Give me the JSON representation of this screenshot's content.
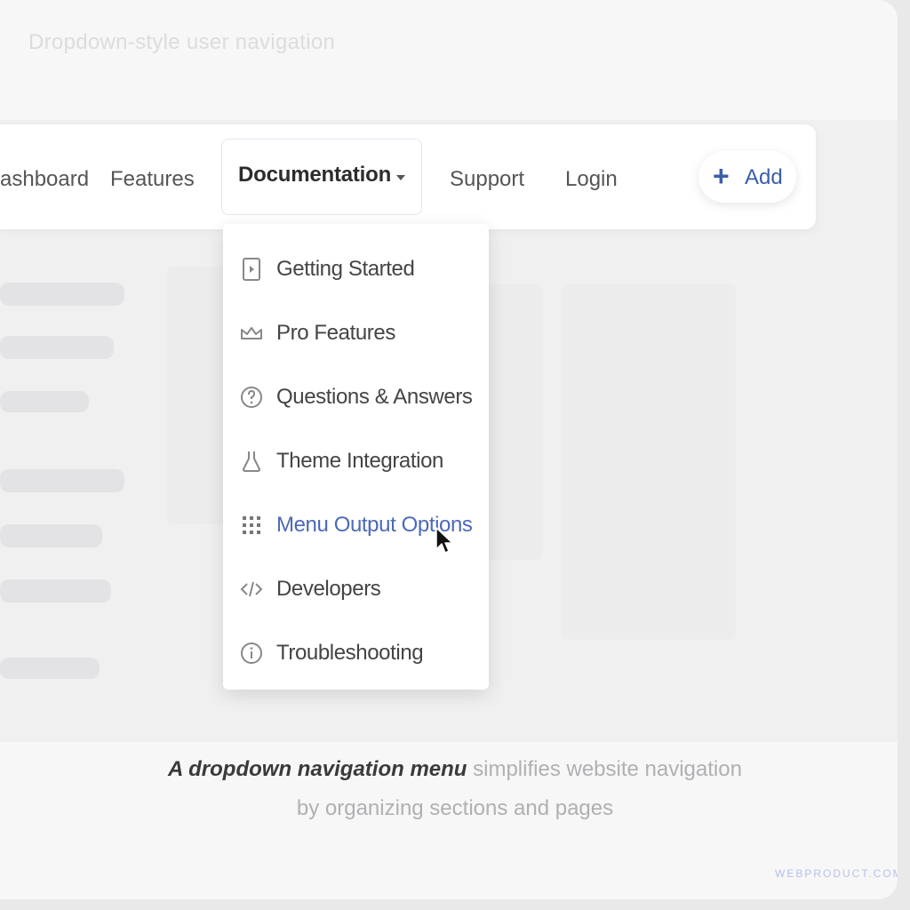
{
  "page_heading": "Dropdown-style user navigation",
  "nav": {
    "items": [
      {
        "label": "ashboard"
      },
      {
        "label": "Features"
      },
      {
        "label": "Documentation"
      },
      {
        "label": "Support"
      },
      {
        "label": "Login"
      }
    ],
    "add_button": {
      "icon": "+",
      "label": "Add"
    }
  },
  "dropdown": {
    "items": [
      {
        "label": "Getting Started",
        "icon": "play-box-icon"
      },
      {
        "label": "Pro Features",
        "icon": "crown-icon"
      },
      {
        "label": "Questions & Answers",
        "icon": "question-circle-icon"
      },
      {
        "label": "Theme Integration",
        "icon": "flask-icon"
      },
      {
        "label": "Menu Output Options",
        "icon": "grid-icon",
        "active": true
      },
      {
        "label": "Developers",
        "icon": "code-icon"
      },
      {
        "label": "Troubleshooting",
        "icon": "info-circle-icon"
      }
    ]
  },
  "caption": {
    "bold": "A dropdown navigation menu",
    "rest": " simplifies website navigation",
    "line2": "by organizing sections and pages"
  },
  "footer_logo": "WEBPRODUCT.COM",
  "colors": {
    "accent": "#4c69b8",
    "nav_add": "#3b5ea8"
  }
}
